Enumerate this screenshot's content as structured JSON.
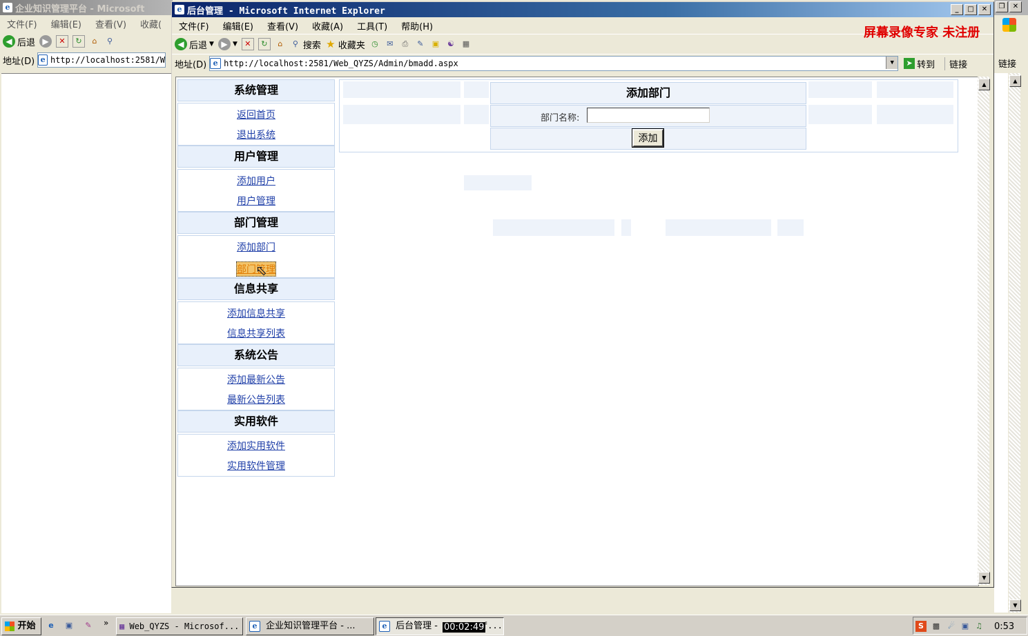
{
  "back_window": {
    "title": "企业知识管理平台 - Microsoft",
    "menu": [
      "文件(F)",
      "编辑(E)",
      "查看(V)",
      "收藏("
    ],
    "back_label": "后退",
    "address_label": "地址(D)",
    "address_value": "http://localhost:2581/W"
  },
  "front_window": {
    "title": "后台管理 - Microsoft Internet Explorer",
    "menu": [
      "文件(F)",
      "编辑(E)",
      "查看(V)",
      "收藏(A)",
      "工具(T)",
      "帮助(H)"
    ],
    "watermark": "屏幕录像专家 未注册",
    "toolbar": {
      "back": "后退",
      "search": "搜索",
      "favorites": "收藏夹"
    },
    "address_label": "地址(D)",
    "address_value": "http://localhost:2581/Web_QYZS/Admin/bmadd.aspx",
    "go_label": "转到",
    "links_label": "链接"
  },
  "right_links_label": "链接",
  "nav": [
    {
      "heading": "系统管理",
      "links": [
        "返回首页",
        "退出系统"
      ]
    },
    {
      "heading": "用户管理",
      "links": [
        "添加用户",
        "用户管理"
      ]
    },
    {
      "heading": "部门管理",
      "links": [
        "添加部门",
        "部门管理"
      ]
    },
    {
      "heading": "信息共享",
      "links": [
        "添加信息共享",
        "信息共享列表"
      ]
    },
    {
      "heading": "系统公告",
      "links": [
        "添加最新公告",
        "最新公告列表"
      ]
    },
    {
      "heading": "实用软件",
      "links": [
        "添加实用软件",
        "实用软件管理"
      ]
    }
  ],
  "form": {
    "title": "添加部门",
    "field_label": "部门名称:",
    "field_value": "",
    "submit_label": "添加"
  },
  "taskbar": {
    "start_label": "开始",
    "tasks": [
      "Web_QYZS - Microsof...",
      "企业知识管理平台 - ...",
      "后台管理 - "
    ],
    "task3_tail": "f...",
    "recording_time": "00:02:49",
    "clock": "0:53"
  }
}
